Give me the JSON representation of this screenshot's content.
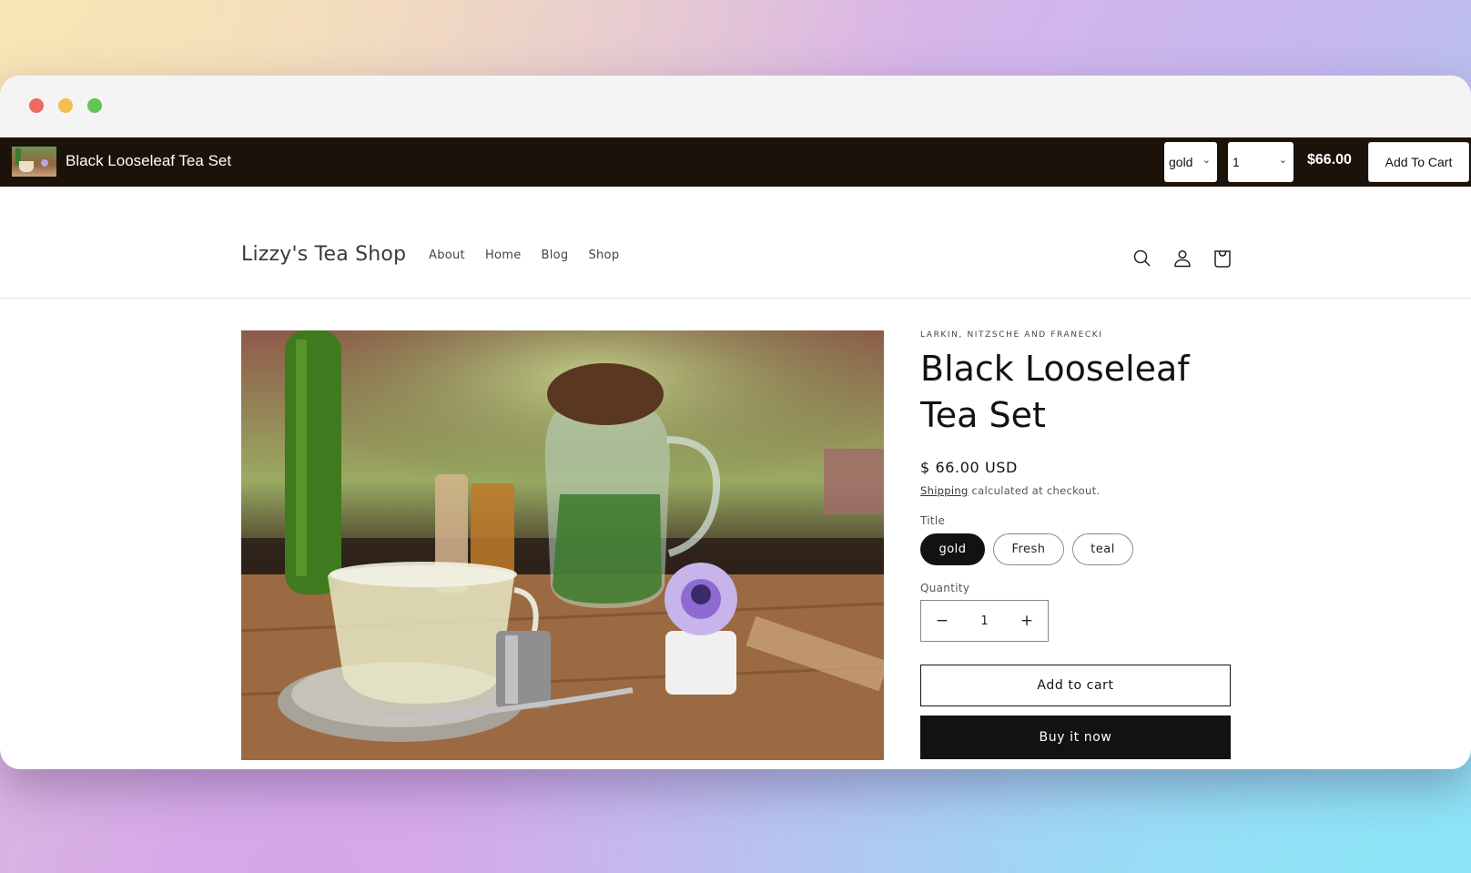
{
  "window": {
    "controls": [
      "close",
      "minimize",
      "maximize"
    ]
  },
  "sticky_bar": {
    "product_title": "Black Looseleaf Tea Set",
    "variant_select": {
      "value": "gold"
    },
    "quantity_select": {
      "value": "1"
    },
    "price": "$66.00",
    "add_button": "Add To Cart"
  },
  "header": {
    "logo": "Lizzy's Tea Shop",
    "nav": [
      {
        "label": "About"
      },
      {
        "label": "Home"
      },
      {
        "label": "Blog"
      },
      {
        "label": "Shop"
      }
    ],
    "icons": [
      "search-icon",
      "account-icon",
      "cart-icon"
    ]
  },
  "product": {
    "image_alt": "Glass tea cup with herbal tea, pitcher with fresh mint, and purple flower on a wooden table",
    "vendor": "LARKIN, NITZSCHE AND FRANECKI",
    "title": "Black Looseleaf Tea Set",
    "price": "$ 66.00 USD",
    "shipping_link": "Shipping",
    "shipping_text": " calculated at checkout.",
    "option_label": "Title",
    "options": [
      {
        "label": "gold",
        "selected": true
      },
      {
        "label": "Fresh",
        "selected": false
      },
      {
        "label": "teal",
        "selected": false
      }
    ],
    "quantity_label": "Quantity",
    "quantity": "1",
    "decrease_symbol": "−",
    "increase_symbol": "+",
    "add_to_cart": "Add to cart",
    "buy_now": "Buy it now"
  },
  "colors": {
    "sticky_bar_bg": "#1b120a",
    "primary": "#121212",
    "close": "#ec6b5e",
    "minimize": "#f4be4f",
    "maximize": "#61c454"
  }
}
